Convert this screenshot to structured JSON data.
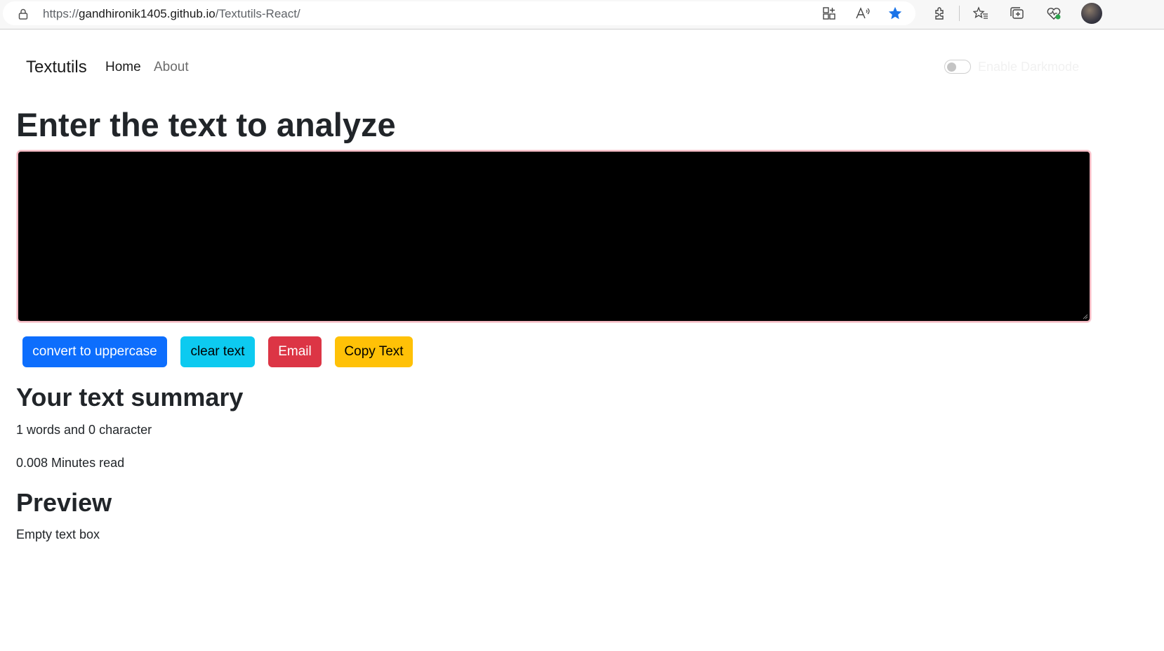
{
  "browser": {
    "url_prefix": "https://",
    "url_host": "gandhironik1405.github.io",
    "url_path": "/Textutils-React/",
    "icons": [
      "lock-icon",
      "app-grid-icon",
      "read-aloud-icon",
      "favorite-star-icon",
      "extensions-icon",
      "favorites-icon",
      "collections-icon",
      "performance-icon",
      "profile-avatar"
    ]
  },
  "navbar": {
    "brand": "Textutils",
    "links": [
      "Home",
      "About"
    ],
    "darkmode_label": "Enable Darkmode",
    "darkmode_enabled": false
  },
  "main": {
    "heading": "Enter the text to analyze",
    "textarea_value": "",
    "buttons": {
      "uppercase": "convert to uppercase",
      "clear": "clear text",
      "email": "Email",
      "copy": "Copy Text"
    },
    "button_colors": {
      "uppercase": "#0d6efd",
      "clear": "#0dcaf0",
      "email": "#dc3545",
      "copy": "#ffc107"
    }
  },
  "summary": {
    "title": "Your text summary",
    "words_line": "1 words and 0 character",
    "read_line": "0.008 Minutes read"
  },
  "preview": {
    "title": "Preview",
    "text": "Empty text box"
  }
}
